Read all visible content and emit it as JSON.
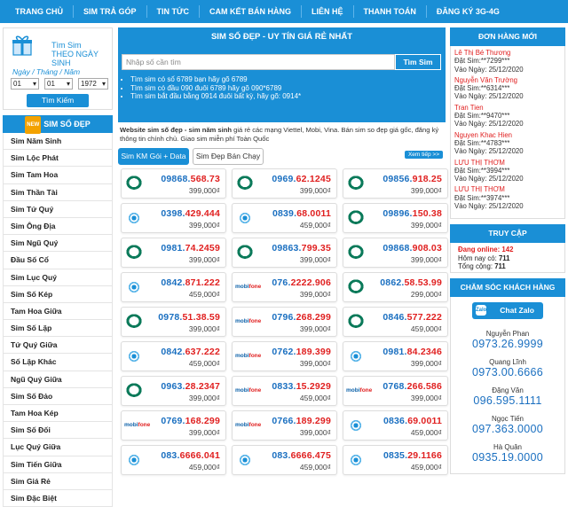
{
  "nav": [
    "TRANG CHỦ",
    "SIM TRẢ GÓP",
    "TIN TỨC",
    "CAM KẾT BÁN HÀNG",
    "LIÊN HỆ",
    "THANH TOÁN",
    "ĐĂNG KÝ 3G-4G"
  ],
  "date_search": {
    "title1": "Tìm Sim",
    "title2": "THEO NGÀY SINH",
    "label": "Ngày / Tháng / Năm",
    "day": "01",
    "month": "01",
    "year": "1972",
    "button": "Tìm Kiếm",
    "icon": "gift-icon"
  },
  "categories": {
    "badge": "NEW",
    "title": "SIM SỐ ĐẸP",
    "items": [
      "Sim Năm Sinh",
      "Sim Lộc Phát",
      "Sim Tam Hoa",
      "Sim Thần Tài",
      "Sim Tứ Quý",
      "Sim Ông Địa",
      "Sim Ngũ Quý",
      "Đầu Số Cổ",
      "Sim Lục Quý",
      "Sim Số Kép",
      "Tam Hoa Giữa",
      "Sim Số Lặp",
      "Tứ Quý Giữa",
      "Số Lặp Khác",
      "Ngũ Quý Giữa",
      "Sim Số Đảo",
      "Tam Hoa Kép",
      "Sim Số Đối",
      "Lục Quý Giữa",
      "Sim Tiến Giữa",
      "Sim Giá Rẻ",
      "Sim Đặc Biệt"
    ]
  },
  "main": {
    "title": "SIM SỐ ĐẸP - UY TÍN GIÁ RẺ NHẤT",
    "search_placeholder": "Nhập số cần tìm",
    "search_button": "Tìm Sim",
    "tips": [
      "Tìm sim có số 6789 bạn hãy gõ 6789",
      "Tìm sim có đầu 090 đuôi 6789 hãy gõ 090*6789",
      "Tìm sim bắt đầu bằng 0914 đuôi bất kỳ, hãy gõ: 0914*"
    ],
    "desc_bold": "Website sim số đẹp - sim năm sinh",
    "desc_rest": " giá rẻ các mạng Viettel, Mobi, Vina. Bán sim so đẹp giá gốc, đăng ký thông tin chính chủ. Giao sim miễn phí Toàn Quốc",
    "tab_active": "Sim KM Gói + Data",
    "tab_other": "Sim Đẹp Bán Chạy",
    "more": "Xem tiếp >>"
  },
  "sims": [
    {
      "carrier": "viettel",
      "head": "09868.",
      "tail": "568.73",
      "price": "399,000₫"
    },
    {
      "carrier": "viettel",
      "head": "0969.",
      "tail": "62.1245",
      "price": "399,000₫"
    },
    {
      "carrier": "viettel",
      "head": "09856.",
      "tail": "918.25",
      "price": "399,000₫"
    },
    {
      "carrier": "vina",
      "head": "0398.",
      "tail": "429.444",
      "price": "399,000₫"
    },
    {
      "carrier": "vina",
      "head": "0839.",
      "tail": "68.0011",
      "price": "459,000₫"
    },
    {
      "carrier": "viettel",
      "head": "09896.",
      "tail": "150.38",
      "price": "399,000₫"
    },
    {
      "carrier": "viettel",
      "head": "0981.",
      "tail": "74.2459",
      "price": "399,000₫"
    },
    {
      "carrier": "viettel",
      "head": "09863.",
      "tail": "799.35",
      "price": "399,000₫"
    },
    {
      "carrier": "viettel",
      "head": "09868.",
      "tail": "908.03",
      "price": "399,000₫"
    },
    {
      "carrier": "vina",
      "head": "0842.",
      "tail": "871.222",
      "price": "459,000₫"
    },
    {
      "carrier": "mobi",
      "head": "076.",
      "tail": "2222.906",
      "price": "399,000₫"
    },
    {
      "carrier": "viettel",
      "head": "0862.",
      "tail": "58.53.99",
      "price": "299,000₫"
    },
    {
      "carrier": "viettel",
      "head": "0978.",
      "tail": "51.38.59",
      "price": "399,000₫"
    },
    {
      "carrier": "mobi",
      "head": "0796.",
      "tail": "268.299",
      "price": "399,000₫"
    },
    {
      "carrier": "viettel",
      "head": "0846.",
      "tail": "577.222",
      "price": "459,000₫"
    },
    {
      "carrier": "vina",
      "head": "0842.",
      "tail": "637.222",
      "price": "459,000₫"
    },
    {
      "carrier": "mobi",
      "head": "0762.",
      "tail": "189.399",
      "price": "399,000₫"
    },
    {
      "carrier": "vina",
      "head": "0981.",
      "tail": "84.2346",
      "price": "399,000₫"
    },
    {
      "carrier": "viettel",
      "head": "0963.",
      "tail": "28.2347",
      "price": "399,000₫"
    },
    {
      "carrier": "mobi",
      "head": "0833.",
      "tail": "15.2929",
      "price": "459,000₫"
    },
    {
      "carrier": "mobi",
      "head": "0768.",
      "tail": "266.586",
      "price": "399,000₫"
    },
    {
      "carrier": "mobi",
      "head": "0769.",
      "tail": "168.299",
      "price": "399,000₫"
    },
    {
      "carrier": "mobi",
      "head": "0766.",
      "tail": "189.299",
      "price": "399,000₫"
    },
    {
      "carrier": "vina",
      "head": "0836.",
      "tail": "69.0011",
      "price": "459,000₫"
    },
    {
      "carrier": "vina",
      "head": "083.",
      "tail": "6666.041",
      "price": "459,000₫"
    },
    {
      "carrier": "vina",
      "head": "083.",
      "tail": "6666.475",
      "price": "459,000₫"
    },
    {
      "carrier": "vina",
      "head": "0835.",
      "tail": "29.1166",
      "price": "459,000₫"
    }
  ],
  "orders": {
    "title": "ĐƠN HÀNG MỚI",
    "list": [
      {
        "name": "Lê Thị Bé Thương",
        "sim": "Đặt Sim:**7299***",
        "date": "Vào Ngày: 25/12/2020"
      },
      {
        "name": "Nguyễn Văn Trường",
        "sim": "Đặt Sim:**6314***",
        "date": "Vào Ngày: 25/12/2020"
      },
      {
        "name": "Tran Tien",
        "sim": "Đặt Sim:**9470***",
        "date": "Vào Ngày: 25/12/2020"
      },
      {
        "name": "Nguyen Khac Hien",
        "sim": "Đặt Sim:**4783***",
        "date": "Vào Ngày: 25/12/2020"
      },
      {
        "name": "LƯU THỊ THƠM",
        "sim": "Đặt Sim:**3994***",
        "date": "Vào Ngày: 25/12/2020"
      },
      {
        "name": "LƯU THỊ THƠM",
        "sim": "Đặt Sim:**3974***",
        "date": "Vào Ngày: 25/12/2020"
      }
    ]
  },
  "stats": {
    "title": "TRUY CẬP",
    "online_label": "Đang online: ",
    "online": "142",
    "today_label": "Hôm nay có: ",
    "today": "711",
    "total_label": "Tổng cộng: ",
    "total": "711"
  },
  "care": {
    "title": "CHĂM SÓC KHÁCH HÀNG",
    "zalo": "Chat Zalo",
    "contacts": [
      {
        "name": "Nguyễn Phan",
        "phone": "0973.26.9999"
      },
      {
        "name": "Quang Lĩnh",
        "phone": "0973.00.6666"
      },
      {
        "name": "Đặng Văn",
        "phone": "096.595.1111"
      },
      {
        "name": "Ngọc Tiến",
        "phone": "097.363.0000"
      },
      {
        "name": "Hà Quân",
        "phone": "0935.19.0000"
      }
    ]
  }
}
